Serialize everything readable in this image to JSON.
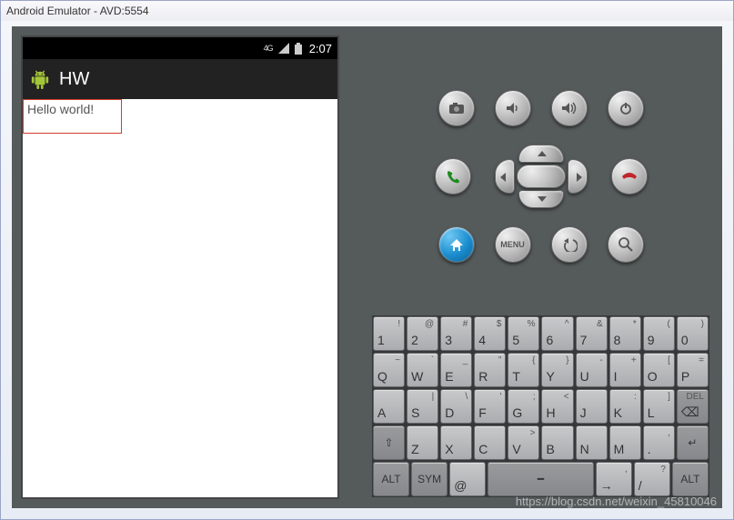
{
  "window": {
    "title": "Android Emulator - AVD:5554"
  },
  "status": {
    "network": "4G",
    "clock": "2:07"
  },
  "app": {
    "title": "HW",
    "content_text": "Hello world!"
  },
  "buttons": {
    "row1": [
      "camera",
      "vol-down",
      "vol-up",
      "power"
    ],
    "row3": [
      "home",
      "menu",
      "back",
      "search"
    ],
    "menu_label": "MENU"
  },
  "keyboard": {
    "r1": [
      {
        "m": "1",
        "s": "!"
      },
      {
        "m": "2",
        "s": "@"
      },
      {
        "m": "3",
        "s": "#"
      },
      {
        "m": "4",
        "s": "$"
      },
      {
        "m": "5",
        "s": "%"
      },
      {
        "m": "6",
        "s": "^"
      },
      {
        "m": "7",
        "s": "&"
      },
      {
        "m": "8",
        "s": "*"
      },
      {
        "m": "9",
        "s": "("
      },
      {
        "m": "0",
        "s": ")"
      }
    ],
    "r2": [
      {
        "m": "Q",
        "s": "~"
      },
      {
        "m": "W",
        "s": "`"
      },
      {
        "m": "E",
        "s": "_"
      },
      {
        "m": "R",
        "s": "\""
      },
      {
        "m": "T",
        "s": "{"
      },
      {
        "m": "Y",
        "s": "}"
      },
      {
        "m": "U",
        "s": "-"
      },
      {
        "m": "I",
        "s": "+"
      },
      {
        "m": "O",
        "s": "["
      },
      {
        "m": "P",
        "s": "="
      }
    ],
    "r3": [
      {
        "m": "A",
        "s": ""
      },
      {
        "m": "S",
        "s": "|"
      },
      {
        "m": "D",
        "s": "\\"
      },
      {
        "m": "F",
        "s": "'"
      },
      {
        "m": "G",
        "s": ";"
      },
      {
        "m": "H",
        "s": "<"
      },
      {
        "m": "J",
        "s": ""
      },
      {
        "m": "K",
        "s": ":"
      },
      {
        "m": "L",
        "s": "]"
      }
    ],
    "r3_del": "DEL",
    "r4": [
      {
        "m": "Z",
        "s": ""
      },
      {
        "m": "X",
        "s": ""
      },
      {
        "m": "C",
        "s": ""
      },
      {
        "m": "V",
        "s": ">"
      },
      {
        "m": "B",
        "s": ""
      },
      {
        "m": "N",
        "s": ""
      },
      {
        "m": "M",
        "s": ""
      },
      {
        "m": ".",
        "s": ","
      }
    ],
    "r5": {
      "alt": "ALT",
      "sym": "SYM",
      "at": "@",
      "slash": "/",
      "comma": ",",
      "question": "?"
    }
  },
  "watermark": "https://blog.csdn.net/weixin_45810046"
}
